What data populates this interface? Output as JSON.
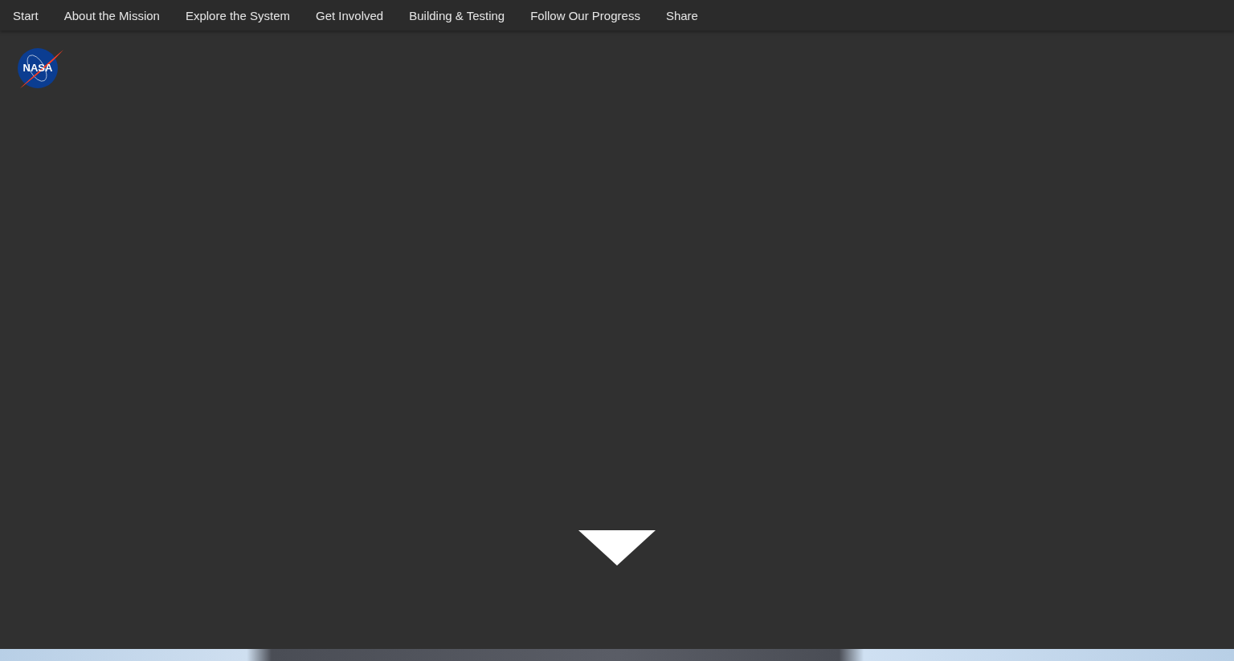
{
  "nav": {
    "items": [
      {
        "label": "Start"
      },
      {
        "label": "About the Mission"
      },
      {
        "label": "Explore the System"
      },
      {
        "label": "Get Involved"
      },
      {
        "label": "Building & Testing"
      },
      {
        "label": "Follow Our Progress"
      },
      {
        "label": "Share"
      }
    ]
  },
  "logo": {
    "text": "NASA"
  }
}
